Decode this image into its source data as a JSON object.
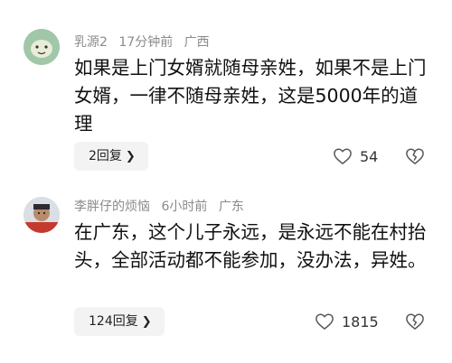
{
  "comments": [
    {
      "username": "乳源2",
      "time": "17分钟前",
      "location": "广西",
      "text": "如果是上门女婿就随母亲姓，如果不是上门女婿，一律不随母亲姓，这是5000年的道理",
      "reply_label": "2回复",
      "likes": "54",
      "avatar_color": "#9dc4a6"
    },
    {
      "username": "李胖仔的烦恼",
      "time": "6小时前",
      "location": "广东",
      "text": "在广东，这个儿子永远，是永远不能在村抬头，全部活动都不能参加，没办法，异姓。",
      "reply_label": "124回复",
      "likes": "1815",
      "avatar_color": "#d7dde3"
    }
  ],
  "icons": {
    "chevron": "chevron-right-icon",
    "like": "heart-icon",
    "dislike": "broken-heart-icon"
  }
}
